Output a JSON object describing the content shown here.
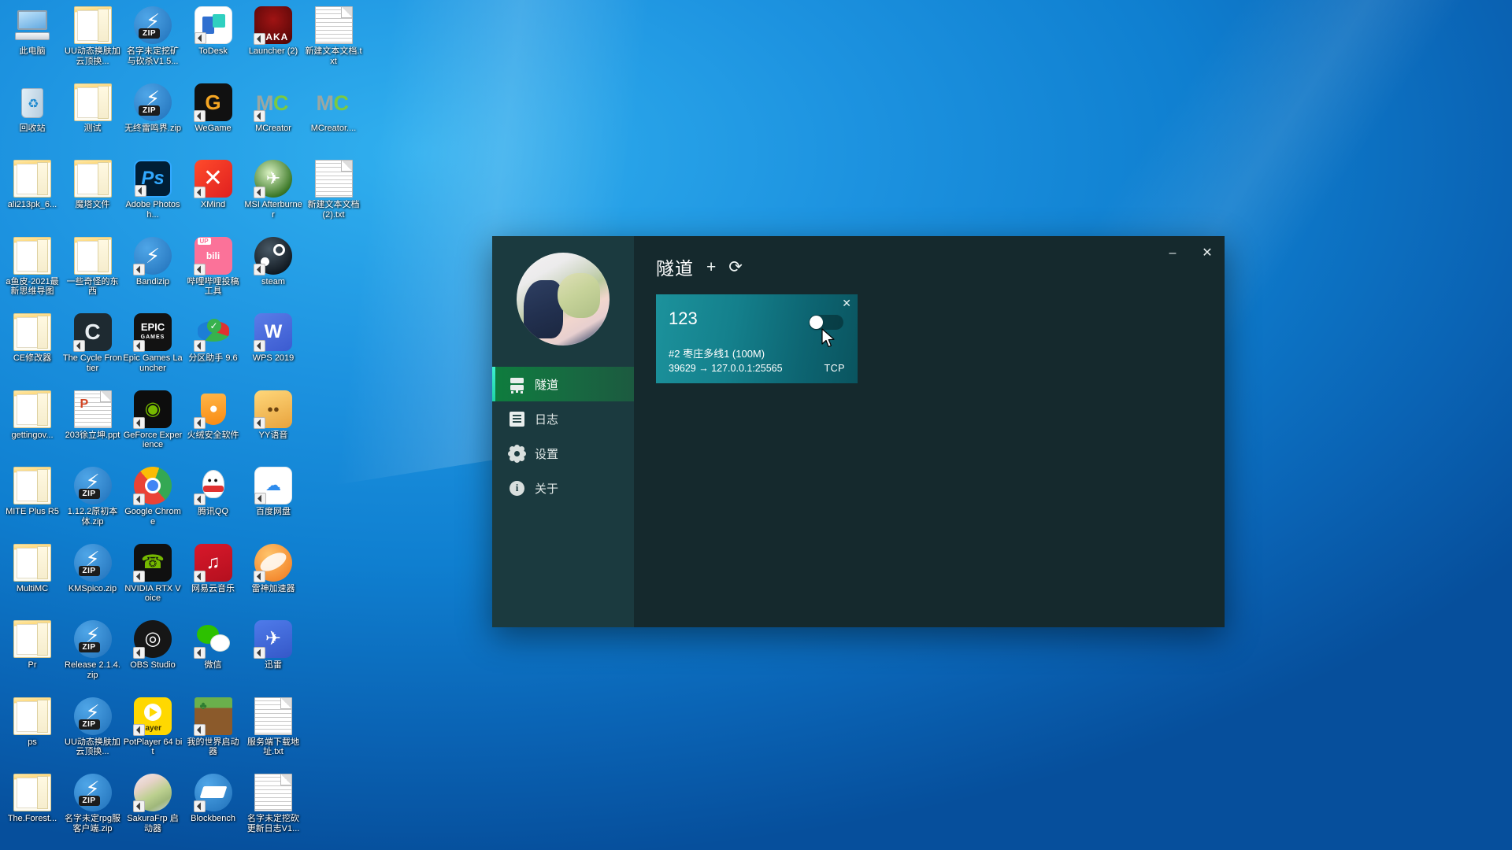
{
  "desktop": {
    "icons": [
      {
        "label": "此电脑",
        "kind": "computer",
        "shortcut": false
      },
      {
        "label": "UU动态换肤加云顶换...",
        "kind": "folder",
        "shortcut": false
      },
      {
        "label": "名字未定挖矿与砍杀V1.5...",
        "kind": "zip",
        "shortcut": false
      },
      {
        "label": "ToDesk",
        "kind": "todesk",
        "shortcut": true
      },
      {
        "label": "Launcher (2)",
        "kind": "raka",
        "shortcut": true
      },
      {
        "label": "新建文本文档.txt",
        "kind": "doc",
        "shortcut": false
      },
      {
        "label": "回收站",
        "kind": "recycle",
        "shortcut": false
      },
      {
        "label": "测试",
        "kind": "folder",
        "shortcut": false
      },
      {
        "label": "无终雷鸣界.zip",
        "kind": "zip",
        "shortcut": false
      },
      {
        "label": "WeGame",
        "kind": "wegame",
        "shortcut": true
      },
      {
        "label": "MCreator",
        "kind": "mcreator",
        "shortcut": true
      },
      {
        "label": "MCreator....",
        "kind": "mcreator",
        "shortcut": false
      },
      {
        "label": "ali213pk_6...",
        "kind": "folder",
        "shortcut": false
      },
      {
        "label": "魔塔文件",
        "kind": "folder",
        "shortcut": false
      },
      {
        "label": "Adobe Photosh...",
        "kind": "photoshop",
        "shortcut": true
      },
      {
        "label": "XMind",
        "kind": "xmind",
        "shortcut": true
      },
      {
        "label": "MSI Afterburner",
        "kind": "msi",
        "shortcut": true
      },
      {
        "label": "新建文本文档 (2).txt",
        "kind": "doc",
        "shortcut": false
      },
      {
        "label": "a鱼皮-2021最新思维导图",
        "kind": "folder",
        "shortcut": false
      },
      {
        "label": "一些奇怪的东西",
        "kind": "folder",
        "shortcut": false
      },
      {
        "label": "Bandizip",
        "kind": "bandizip",
        "shortcut": true
      },
      {
        "label": "哔哩哔哩投稿工具",
        "kind": "bilibili",
        "shortcut": true
      },
      {
        "label": "steam",
        "kind": "steam",
        "shortcut": true
      },
      {
        "label": "CE修改器",
        "kind": "folder",
        "shortcut": false
      },
      {
        "label": "The Cycle Frontier",
        "kind": "cycle",
        "shortcut": true
      },
      {
        "label": "Epic Games Launcher",
        "kind": "epic",
        "shortcut": true
      },
      {
        "label": "分区助手 9.6",
        "kind": "partition",
        "shortcut": true
      },
      {
        "label": "WPS 2019",
        "kind": "wps",
        "shortcut": true
      },
      {
        "label": "gettingov...",
        "kind": "folder",
        "shortcut": false
      },
      {
        "label": "203徐立坤.ppt",
        "kind": "ppt",
        "shortcut": false
      },
      {
        "label": "GeForce Experience",
        "kind": "geforce",
        "shortcut": true
      },
      {
        "label": "火绒安全软件",
        "kind": "huorong",
        "shortcut": true
      },
      {
        "label": "YY语音",
        "kind": "yy",
        "shortcut": true
      },
      {
        "label": "MITE Plus R5",
        "kind": "folder",
        "shortcut": false
      },
      {
        "label": "1.12.2原初本体.zip",
        "kind": "zip",
        "shortcut": false
      },
      {
        "label": "Google Chrome",
        "kind": "chrome",
        "shortcut": true
      },
      {
        "label": "腾讯QQ",
        "kind": "qq",
        "shortcut": true
      },
      {
        "label": "百度网盘",
        "kind": "baidu",
        "shortcut": true
      },
      {
        "label": "MultiMC",
        "kind": "folder",
        "shortcut": false
      },
      {
        "label": "KMSpico.zip",
        "kind": "zip",
        "shortcut": false
      },
      {
        "label": "NVIDIA RTX Voice",
        "kind": "rtxvoice",
        "shortcut": true
      },
      {
        "label": "网易云音乐",
        "kind": "netease",
        "shortcut": true
      },
      {
        "label": "雷神加速器",
        "kind": "leishen",
        "shortcut": true
      },
      {
        "label": "Pr",
        "kind": "folder",
        "shortcut": false
      },
      {
        "label": "Release 2.1.4.zip",
        "kind": "zip",
        "shortcut": false
      },
      {
        "label": "OBS Studio",
        "kind": "obs",
        "shortcut": true
      },
      {
        "label": "微信",
        "kind": "wechat",
        "shortcut": true
      },
      {
        "label": "迅雷",
        "kind": "xunlei",
        "shortcut": true
      },
      {
        "label": "ps",
        "kind": "folder",
        "shortcut": false
      },
      {
        "label": "UU动态换肤加云顶换...",
        "kind": "zip",
        "shortcut": false
      },
      {
        "label": "PotPlayer 64 bit",
        "kind": "potplayer",
        "shortcut": true
      },
      {
        "label": "我的世界启动器",
        "kind": "minecraft",
        "shortcut": true
      },
      {
        "label": "服务端下载地址.txt",
        "kind": "doc",
        "shortcut": false
      },
      {
        "label": "The.Forest...",
        "kind": "folder",
        "shortcut": false
      },
      {
        "label": "名字未定rpg服客户端.zip",
        "kind": "zip",
        "shortcut": false
      },
      {
        "label": "SakuraFrp 启动器",
        "kind": "sakura",
        "shortcut": true
      },
      {
        "label": "Blockbench",
        "kind": "blockbench",
        "shortcut": true
      },
      {
        "label": "名字未定挖砍更新日志V1...",
        "kind": "doc",
        "shortcut": false
      }
    ]
  },
  "window": {
    "controls": {
      "minimize": "–",
      "close": "✕"
    },
    "sidebar": {
      "avatar_name": "user-avatar",
      "items": [
        {
          "label": "隧道",
          "icon": "server-icon",
          "active": true
        },
        {
          "label": "日志",
          "icon": "list-icon",
          "active": false
        },
        {
          "label": "设置",
          "icon": "gear-icon",
          "active": false
        },
        {
          "label": "关于",
          "icon": "info-icon",
          "active": false
        }
      ]
    },
    "header": {
      "title": "隧道",
      "add_label": "+",
      "refresh_label": "⟳"
    },
    "tunnels": [
      {
        "name": "123",
        "enabled": false,
        "close_label": "✕",
        "node": "#2 枣庄多线1 (100M)",
        "mapping": "39629 → 127.0.0.1:25565",
        "protocol": "TCP"
      }
    ]
  },
  "colors": {
    "accent_green": "#0e7d3e",
    "accent_cyan": "#3ef0d0",
    "card_teal": "#14808c",
    "window_bg": "#15292d",
    "sidebar_bg": "#1b3a3f",
    "desktop_blue": "#1d93e0"
  }
}
